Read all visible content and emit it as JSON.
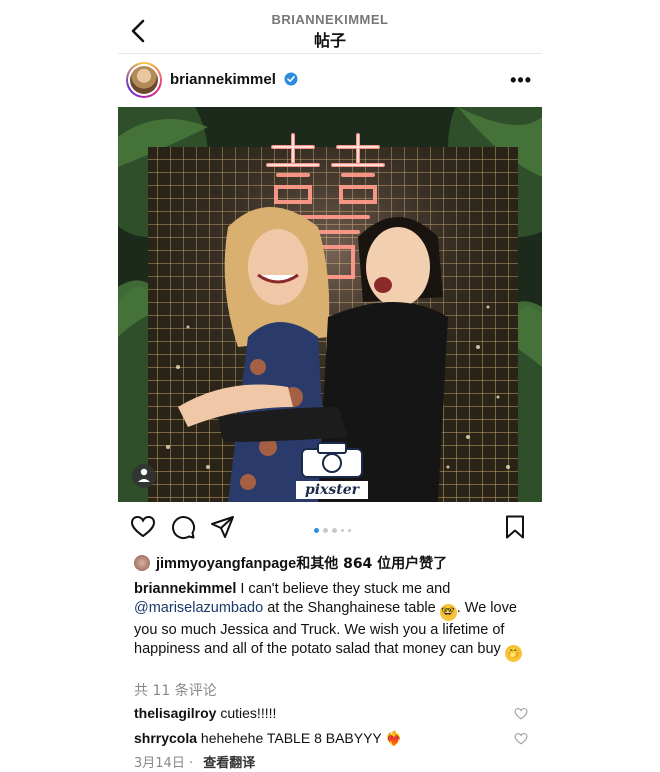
{
  "header": {
    "username": "BRIANNEKIMMEL",
    "subtitle": "帖子"
  },
  "post": {
    "username": "briannekimmel",
    "verified_icon": "verified-badge-icon",
    "more_icon": "more-dots-icon",
    "photo": {
      "watermark": "pixster",
      "neon_sign_color": "#ff6e6e"
    },
    "carousel": {
      "count": 5,
      "active": 0
    }
  },
  "likes": {
    "user": "jimmyoyangfanpage",
    "rest": "和其他 864 位用户赞了"
  },
  "caption": {
    "user": "briannekimmel",
    "text_1": " I can't believe they stuck me and ",
    "mention": "@mariselazumbado",
    "text_2": " at the Shanghainese table ",
    "text_3": ". We love you so much Jessica and Truck. We wish you a lifetime of happiness and all of the potato salad that money can buy ",
    "emoji_1": "🤓",
    "emoji_2": "🤭"
  },
  "view_comments": "共 11 条评论",
  "comments": [
    {
      "user": "thelisagilroy",
      "text": " cuties!!!!!",
      "emoji": ""
    },
    {
      "user": "shrrycola",
      "text": " hehehehe TABLE 8 BABYYY ",
      "emoji": "❤️‍🔥"
    }
  ],
  "date": {
    "text": "3月14日 · ",
    "translate": "查看翻译"
  },
  "colors": {
    "accent_blue": "#2d8ce0",
    "mention": "#1a3a6b",
    "muted": "#888888"
  }
}
